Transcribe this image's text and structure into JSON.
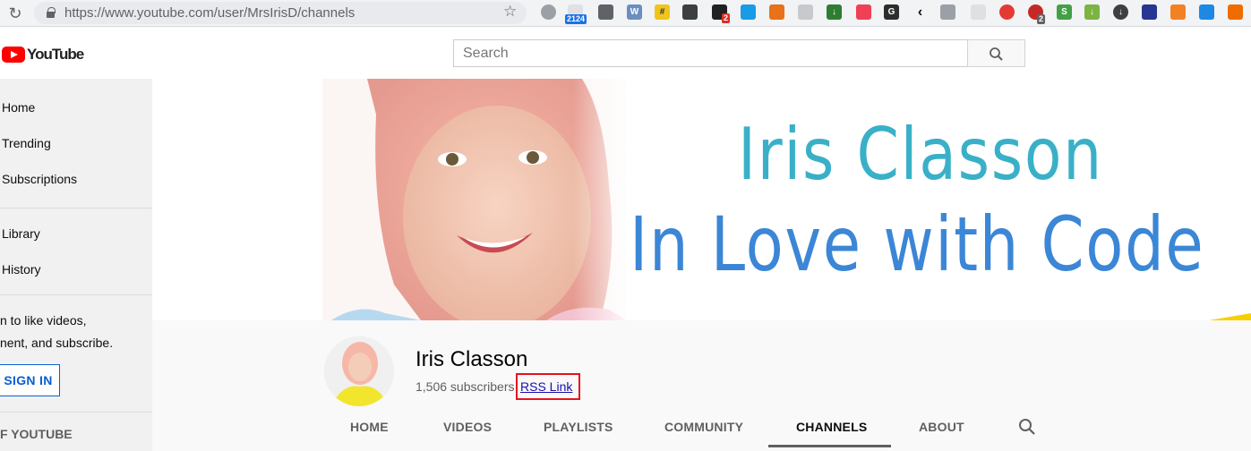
{
  "browser": {
    "url": "https://www.youtube.com/user/MrsIrisD/channels",
    "extension_badges": [
      "2124",
      "2",
      "2"
    ]
  },
  "masthead": {
    "logo_text": "YouTube",
    "search_placeholder": "Search"
  },
  "sidebar": {
    "items": [
      {
        "label": "Home"
      },
      {
        "label": "Trending"
      },
      {
        "label": "Subscriptions"
      },
      {
        "label": "Library"
      },
      {
        "label": "History"
      }
    ],
    "signin_prompt_line1": "n to like videos,",
    "signin_prompt_line2": "nent, and subscribe.",
    "signin_button": "SIGN IN",
    "section_title": "F YOUTUBE"
  },
  "banner": {
    "line1": "Iris Classon",
    "line2": "In Love with Code"
  },
  "channel": {
    "name": "Iris Classon",
    "subscribers": "1,506 subscribers",
    "rss_label": "RSS Link"
  },
  "tabs": [
    {
      "label": "HOME"
    },
    {
      "label": "VIDEOS"
    },
    {
      "label": "PLAYLISTS"
    },
    {
      "label": "COMMUNITY"
    },
    {
      "label": "CHANNELS",
      "active": true
    },
    {
      "label": "ABOUT"
    }
  ],
  "colors": {
    "brand_red": "#ff0000",
    "link_blue": "#065fd4",
    "banner_teal": "#3ab0c8",
    "banner_blue": "#3b86d6",
    "highlight_red": "#e8121b"
  }
}
